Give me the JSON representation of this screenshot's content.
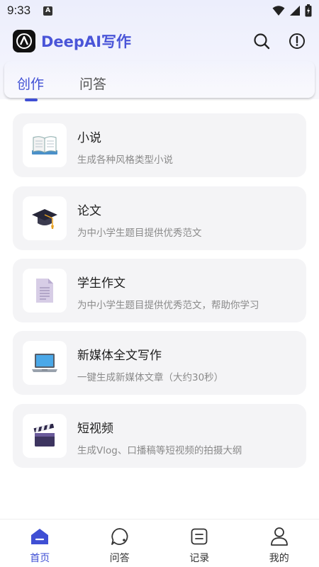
{
  "status": {
    "time": "9:33",
    "a_label": "A"
  },
  "app": {
    "title": "DeepAI写作"
  },
  "header": {
    "icons": [
      "search-icon",
      "info-icon"
    ]
  },
  "tabs": [
    {
      "label": "创作",
      "active": true
    },
    {
      "label": "问答",
      "active": false
    }
  ],
  "cards": [
    {
      "title": "小说",
      "desc": "生成各种风格类型小说",
      "icon": "book-icon"
    },
    {
      "title": "论文",
      "desc": "为中小学生题目提供优秀范文",
      "icon": "graduation-cap-icon"
    },
    {
      "title": "学生作文",
      "desc": "为中小学生题目提供优秀范文，帮助你学习",
      "icon": "document-icon"
    },
    {
      "title": "新媒体全文写作",
      "desc": "一键生成新媒体文章（大约30秒）",
      "icon": "laptop-icon"
    },
    {
      "title": "短视频",
      "desc": "生成Vlog、口播稿等短视频的拍摄大纲",
      "icon": "clapperboard-icon"
    }
  ],
  "nav": [
    {
      "label": "首页",
      "icon": "home-icon",
      "active": true
    },
    {
      "label": "问答",
      "icon": "chat-icon",
      "active": false
    },
    {
      "label": "记录",
      "icon": "record-icon",
      "active": false
    },
    {
      "label": "我的",
      "icon": "profile-icon",
      "active": false
    }
  ],
  "colors": {
    "accent": "#3f4fd4",
    "title": "#4a55d8",
    "card_bg": "#f4f4f6"
  }
}
